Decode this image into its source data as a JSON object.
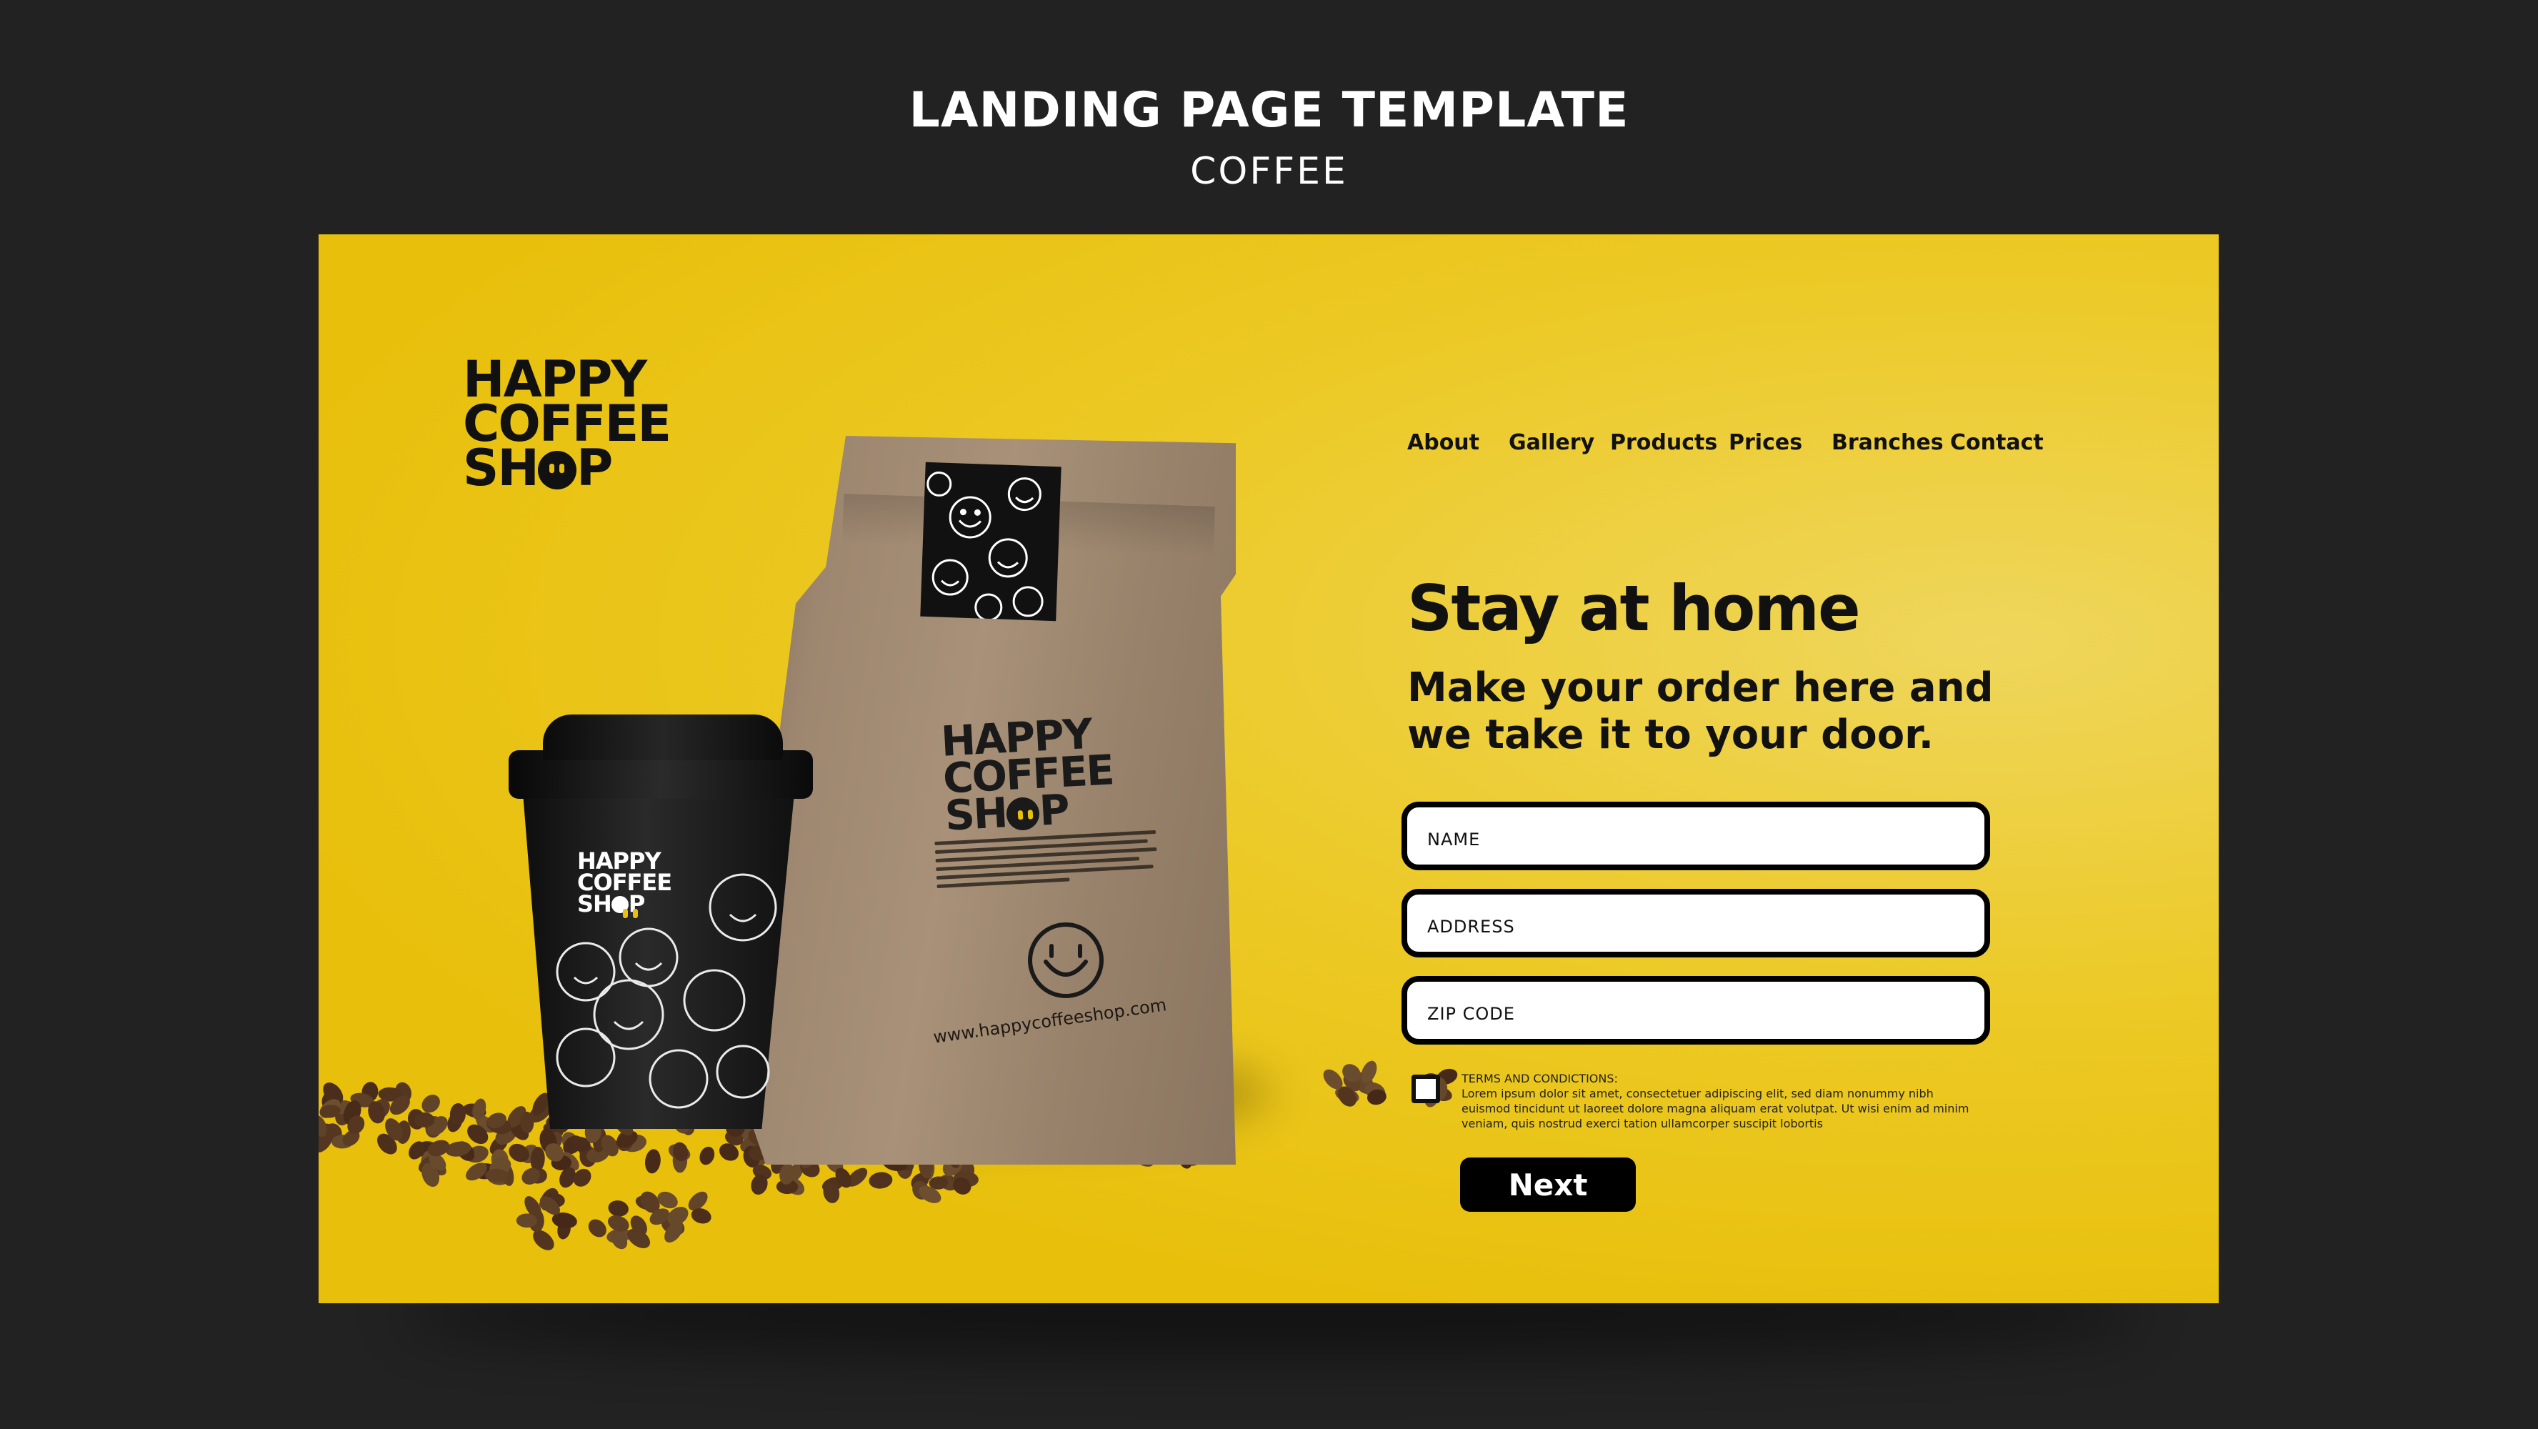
{
  "header": {
    "title": "LANDING PAGE TEMPLATE",
    "subtitle": "COFFEE"
  },
  "logo": {
    "line1": "HAPPY",
    "line2": "COFFEE",
    "line3a": "SH",
    "line3b": "P"
  },
  "nav": {
    "items": [
      "About",
      "Gallery",
      "Products",
      "Prices",
      "Branches",
      "Contact"
    ]
  },
  "hero": {
    "title": "Stay at home",
    "text": "Make your order here and we take it to your door."
  },
  "form": {
    "name_placeholder": "NAME",
    "address_placeholder": "ADDRESS",
    "zip_placeholder": "ZIP CODE",
    "terms_title": "TERMS AND CONDICTIONS:",
    "terms_body": "Lorem ipsum dolor sit amet, consectetuer adipiscing elit, sed diam nonummy nibh euismod tincidunt ut laoreet dolore magna aliquam erat volutpat. Ut wisi enim ad minim veniam, quis nostrud exerci tation ullamcorper suscipit lobortis",
    "next_label": "Next"
  },
  "products": {
    "bag_url": "www.happycoffeeshop.com"
  },
  "colors": {
    "background": "#222222",
    "accent_yellow": "#e8c00c",
    "text_dark": "#111111"
  }
}
